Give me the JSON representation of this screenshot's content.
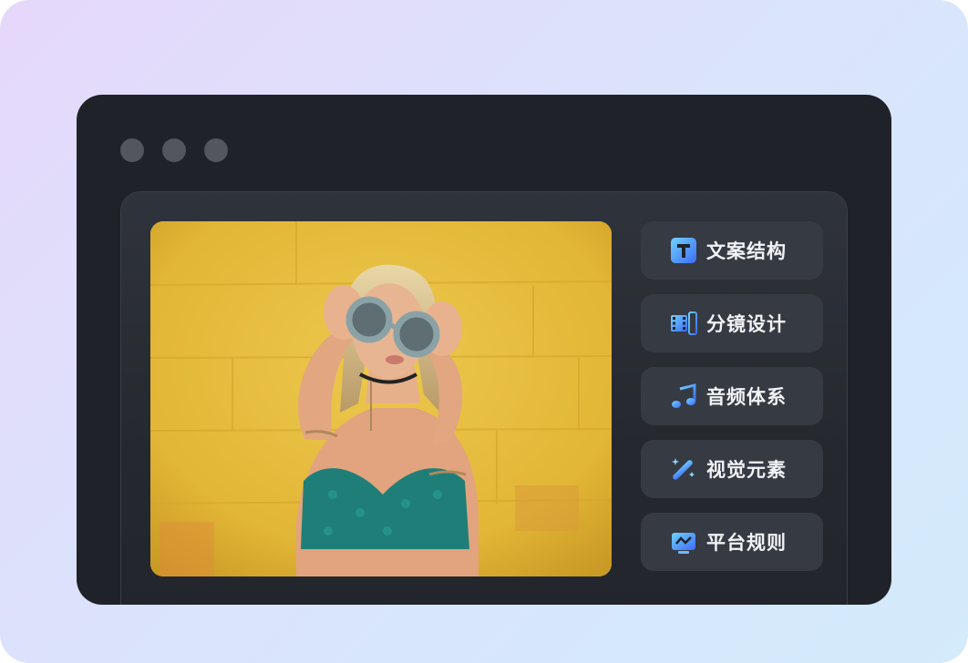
{
  "window": {
    "controls": [
      "dot",
      "dot",
      "dot"
    ]
  },
  "preview": {
    "image": "photo-woman-round-glasses-yellow-wall"
  },
  "menu": {
    "items": [
      {
        "label": "文案结构",
        "icon": "text-t-icon"
      },
      {
        "label": "分镜设计",
        "icon": "film-strip-icon"
      },
      {
        "label": "音频体系",
        "icon": "music-note-icon"
      },
      {
        "label": "视觉元素",
        "icon": "magic-wand-icon"
      },
      {
        "label": "平台规则",
        "icon": "monitor-chart-icon"
      }
    ]
  },
  "colors": {
    "accent_gradient_start": "#6fd3ff",
    "accent_gradient_end": "#3d6cf5",
    "window_bg": "#1f2229",
    "button_bg": "#363a43"
  }
}
